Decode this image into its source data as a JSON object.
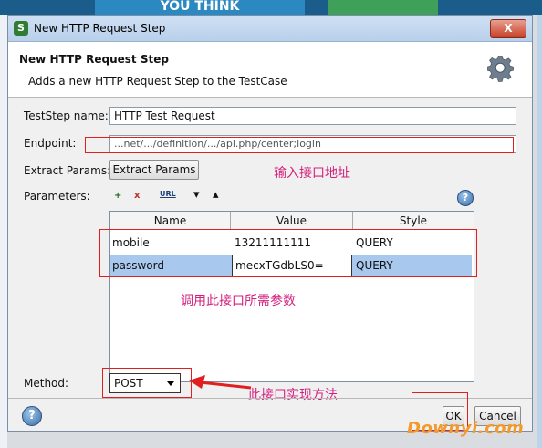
{
  "background": {
    "banner_text": "YOU THINK"
  },
  "window": {
    "title": "New HTTP Request Step",
    "close_label": "X",
    "app_icon_label": "S"
  },
  "header": {
    "title": "New HTTP Request Step",
    "description": "Adds a new HTTP Request Step to the TestCase"
  },
  "form": {
    "teststep_name_label": "TestStep name:",
    "teststep_name_value": "HTTP Test Request",
    "endpoint_label": "Endpoint:",
    "endpoint_value": "...net/.../definition/.../api.php/center;login",
    "extract_params_label": "Extract Params:",
    "extract_params_button": "Extract Params",
    "parameters_label": "Parameters:",
    "method_label": "Method:",
    "method_value": "POST"
  },
  "toolbar": {
    "add_icon": "+",
    "remove_icon": "x",
    "param_icon": "URL",
    "down_icon": "▾",
    "up_icon": "▴",
    "help_icon": "?"
  },
  "table": {
    "columns": [
      "Name",
      "Value",
      "Style"
    ],
    "rows": [
      {
        "name": "mobile",
        "value": "13211111111",
        "style": "QUERY"
      },
      {
        "name": "password",
        "value": "mecxTGdbLS0=",
        "style": "QUERY"
      }
    ]
  },
  "annotations": {
    "endpoint": "输入接口地址",
    "params": "调用此接口所需参数",
    "method": "此接口实现方法"
  },
  "footer": {
    "ok_label": "OK",
    "cancel_label": "Cancel",
    "help_icon": "?",
    "watermark": "Downyi.com"
  },
  "colors": {
    "annotation": "#d4207e",
    "highlight_box": "#e02020",
    "selected_row": "#a8c8ee",
    "watermark": "#f39a2c"
  }
}
